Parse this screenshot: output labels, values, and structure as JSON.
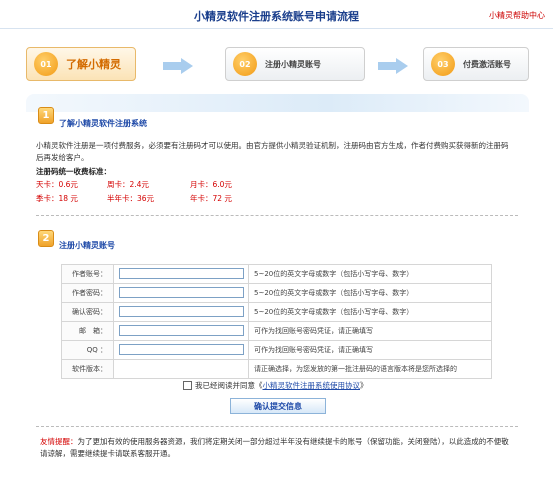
{
  "header": {
    "title": "小精灵软件注册系统账号申请流程",
    "help_link": "小精灵帮助中心"
  },
  "steps": [
    {
      "num": "01",
      "label": "了解小精灵"
    },
    {
      "num": "02",
      "label": "注册小精灵账号"
    },
    {
      "num": "03",
      "label": "付费激活账号"
    }
  ],
  "section1": {
    "icon_num": "1",
    "title": "了解小精灵软件注册系统",
    "intro": "小精灵软件注册是一项付费服务，必须要有注册码才可以使用。由官方提供小精灵验证机制，注册码由官方生成，作者付费购买获得新的注册码后再发给客户。",
    "price_heading": "注册码统一收费标准：",
    "prices": [
      [
        "天卡：0.6元",
        "周卡：2.4元",
        "月卡：6.0元"
      ],
      [
        "季卡：18 元",
        "半年卡：36元",
        "年卡：72 元"
      ]
    ]
  },
  "section2": {
    "icon_num": "2",
    "title": "注册小精灵账号",
    "rows": [
      {
        "label": "作者账号：",
        "hint": "5~20位的英文字母或数字（包括小写字母、数字）"
      },
      {
        "label": "作者密码：",
        "hint": "5~20位的英文字母或数字（包括小写字母、数字）"
      },
      {
        "label": "确认密码：",
        "hint": "5~20位的英文字母或数字（包括小写字母、数字）"
      },
      {
        "label": "邮　箱：",
        "hint": "可作为找回账号密码凭证，请正确填写"
      },
      {
        "label": "QQ ：",
        "hint": "可作为找回账号密码凭证，请正确填写"
      }
    ],
    "version_label": "软件版本：",
    "version_hint": "请正确选择，为您发放的第一批注册码的语言版本将是您所选择的",
    "agree_text": "我已经阅读并同意《",
    "agree_link": "小精灵软件注册系统使用协议",
    "agree_end": "》",
    "submit_label": "确认提交信息"
  },
  "tip": {
    "prefix": "友情提醒：",
    "text": "为了更加有效的使用服务器资源，我们将定期关闭一部分超过半年没有继续提卡的账号（保留功能，关闭登陆），以此造成的不便敬请谅解，需要继续提卡请联系客服开通。"
  },
  "colors": {
    "accent": "#f29a14",
    "title_blue": "#1a3e8c",
    "link_blue": "#1f4aa8",
    "price_red": "#d40000"
  }
}
